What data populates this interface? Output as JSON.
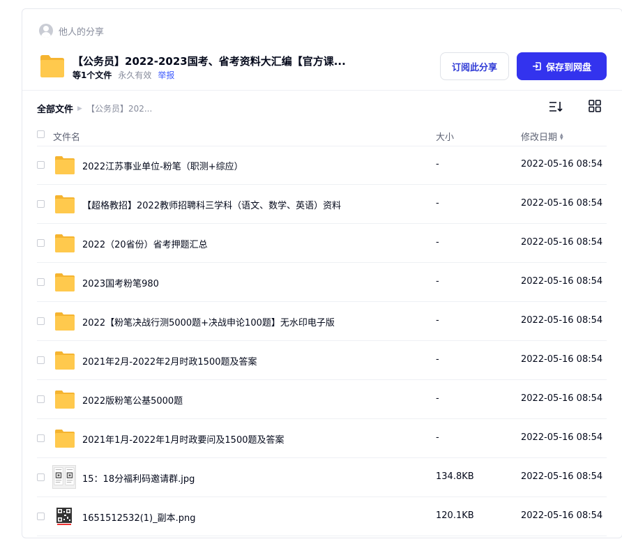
{
  "share": {
    "sharer_label": "他人的分享",
    "title": "【公务员】2022-2023国考、省考资料大汇编【官方课...",
    "file_count": "等1个文件",
    "validity": "永久有效",
    "report": "举报",
    "subscribe_label": "订阅此分享",
    "save_label": "保存到网盘"
  },
  "breadcrumb": {
    "root": "全部文件",
    "current": "【公务员】202..."
  },
  "table": {
    "headers": {
      "name": "文件名",
      "size": "大小",
      "date": "修改日期"
    },
    "rows": [
      {
        "type": "folder",
        "name": "2022江苏事业单位-粉笔（职测+综应）",
        "size": "-",
        "date": "2022-05-16 08:54"
      },
      {
        "type": "folder",
        "name": "【超格教招】2022教师招聘科三学科（语文、数学、英语）资料",
        "size": "-",
        "date": "2022-05-16 08:54"
      },
      {
        "type": "folder",
        "name": "2022（20省份）省考押题汇总",
        "size": "-",
        "date": "2022-05-16 08:54"
      },
      {
        "type": "folder",
        "name": "2023国考粉笔980",
        "size": "-",
        "date": "2022-05-16 08:54"
      },
      {
        "type": "folder",
        "name": "2022【粉笔决战行测5000题+决战申论100题】无水印电子版",
        "size": "-",
        "date": "2022-05-16 08:54"
      },
      {
        "type": "folder",
        "name": "2021年2月-2022年2月时政1500题及答案",
        "size": "-",
        "date": "2022-05-16 08:54"
      },
      {
        "type": "folder",
        "name": "2022版粉笔公基5000题",
        "size": "-",
        "date": "2022-05-16 08:54"
      },
      {
        "type": "folder",
        "name": "2021年1月-2022年1月时政要问及1500题及答案",
        "size": "-",
        "date": "2022-05-16 08:54"
      },
      {
        "type": "jpg",
        "name": "15：18分福利码邀请群.jpg",
        "size": "134.8KB",
        "date": "2022-05-16 08:54"
      },
      {
        "type": "png",
        "name": "1651512532(1)_副本.png",
        "size": "120.1KB",
        "date": "2022-05-16 08:54"
      }
    ]
  },
  "colors": {
    "accent": "#3333ee",
    "folder": "#ffc94d",
    "folder_dark": "#f5b430"
  }
}
